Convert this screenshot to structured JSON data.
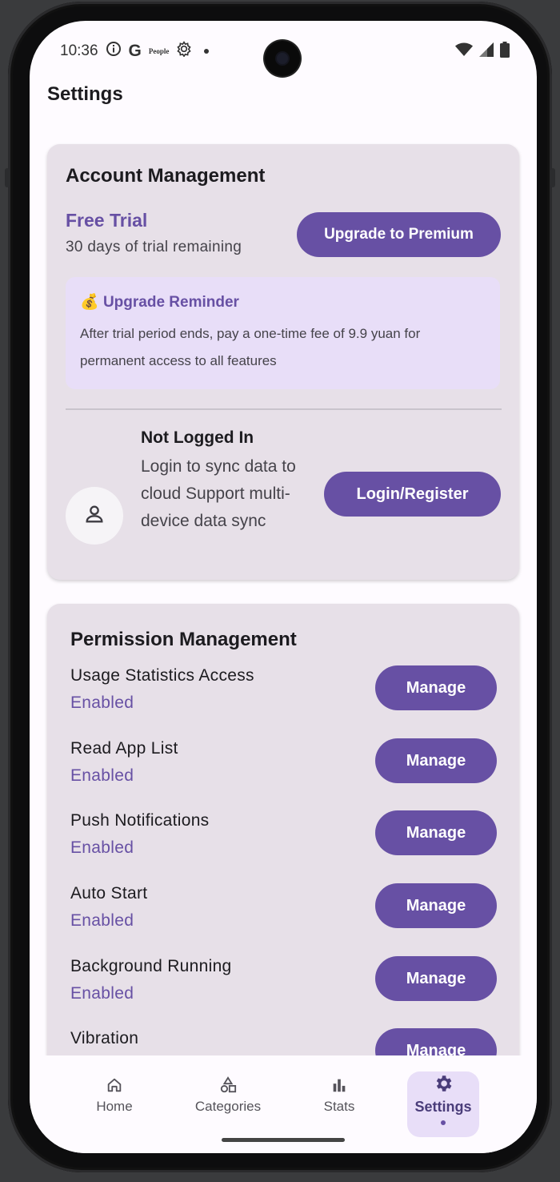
{
  "status_bar": {
    "time": "10:36",
    "people_label": "People"
  },
  "page": {
    "title": "Settings"
  },
  "account": {
    "title": "Account Management",
    "trial_title": "Free Trial",
    "trial_remaining": "30 days of trial remaining",
    "upgrade_button": "Upgrade to Premium",
    "reminder_icon": "💰",
    "reminder_title": "Upgrade Reminder",
    "reminder_body": "After trial period ends, pay a one-time fee of 9.9 yuan for permanent access to all features",
    "login_title": "Not Logged In",
    "login_desc": "Login to sync data to cloud Support multi-device data sync",
    "login_button": "Login/Register"
  },
  "permissions": {
    "title": "Permission Management",
    "items": [
      {
        "name": "Usage Statistics Access",
        "status": "Enabled",
        "button": "Manage"
      },
      {
        "name": "Read App List",
        "status": "Enabled",
        "button": "Manage"
      },
      {
        "name": "Push Notifications",
        "status": "Enabled",
        "button": "Manage"
      },
      {
        "name": "Auto Start",
        "status": "Enabled",
        "button": "Manage"
      },
      {
        "name": "Background Running",
        "status": "Enabled",
        "button": "Manage"
      },
      {
        "name": "Vibration",
        "status": "",
        "button": "Manage"
      }
    ]
  },
  "nav": {
    "items": [
      {
        "label": "Home",
        "icon": "home-icon"
      },
      {
        "label": "Categories",
        "icon": "categories-icon"
      },
      {
        "label": "Stats",
        "icon": "bar-chart-icon"
      },
      {
        "label": "Settings",
        "icon": "gear-icon"
      }
    ],
    "active": "Settings"
  },
  "colors": {
    "primary": "#6750a4",
    "card": "#e7e0e8",
    "reminder_bg": "#e8def8"
  }
}
